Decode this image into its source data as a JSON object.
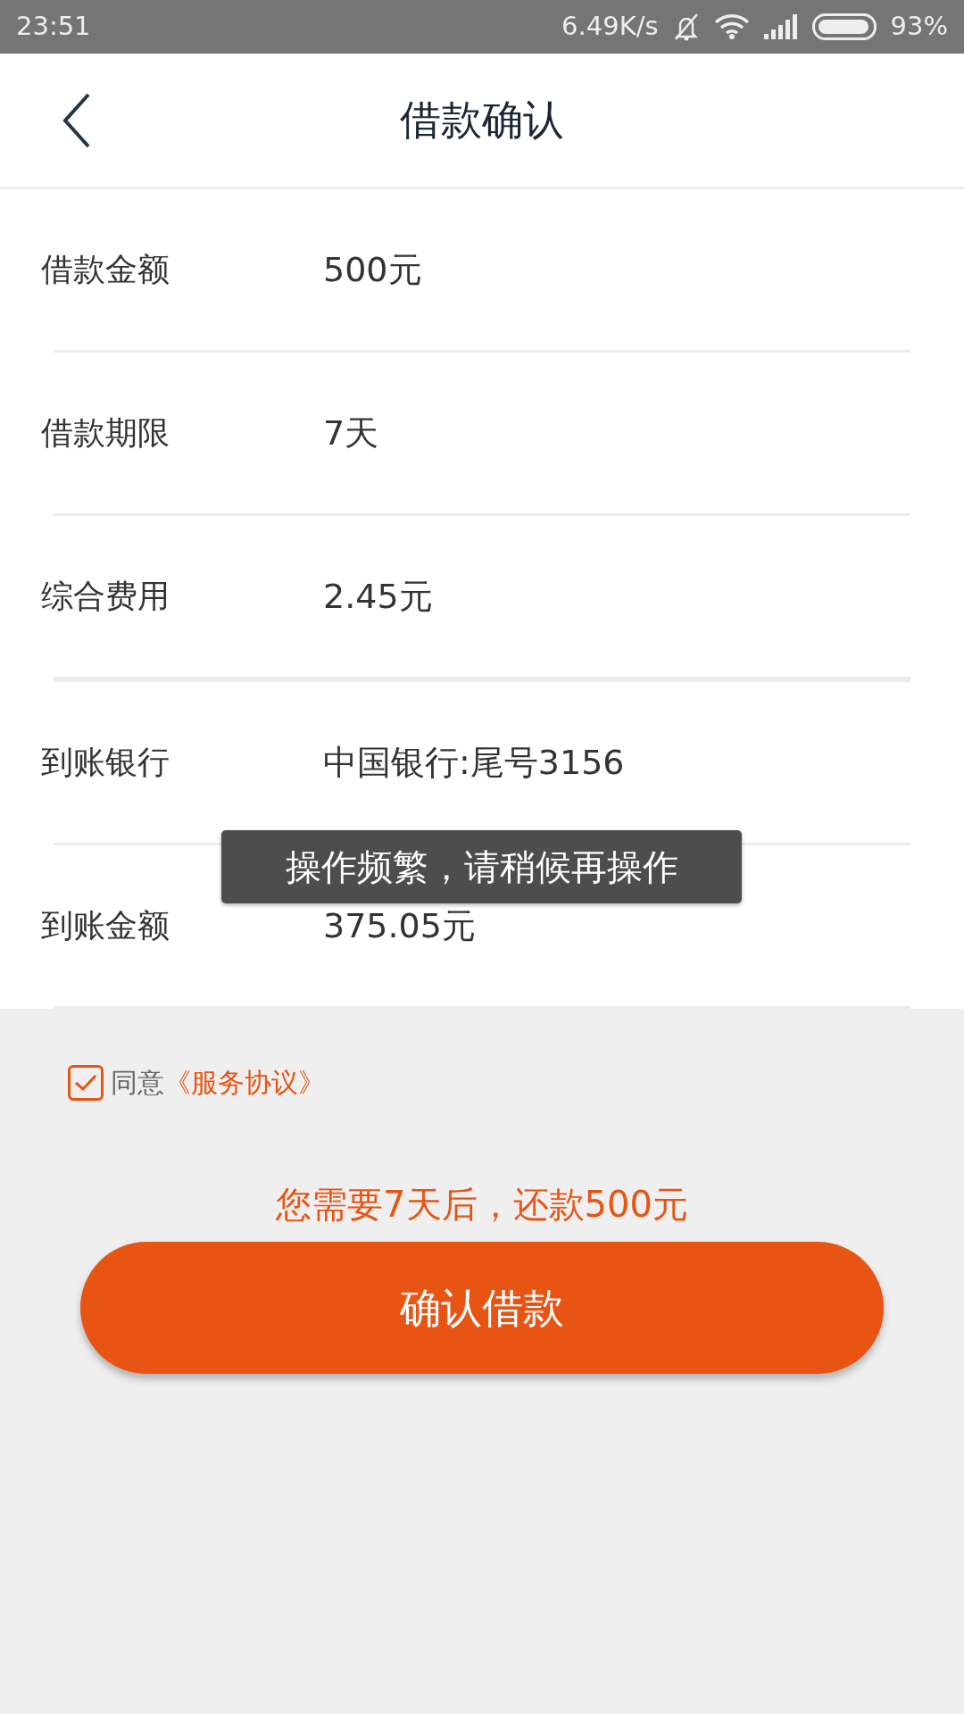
{
  "status_bar": {
    "time": "23:51",
    "speed": "6.49K/s",
    "battery": "93%"
  },
  "header": {
    "title": "借款确认"
  },
  "rows": [
    {
      "label": "借款金额",
      "value": "500元"
    },
    {
      "label": "借款期限",
      "value": "7天"
    },
    {
      "label": "综合费用",
      "value": "2.45元"
    },
    {
      "label": "到账银行",
      "value": "中国银行:尾号3156"
    },
    {
      "label": "到账金额",
      "value": "375.05元"
    }
  ],
  "agreement": {
    "checked": true,
    "text": "同意",
    "link": "《服务协议》"
  },
  "repay_note": "您需要7天后，还款500元",
  "confirm_button": "确认借款",
  "toast": "操作频繁，请稍候再操作"
}
